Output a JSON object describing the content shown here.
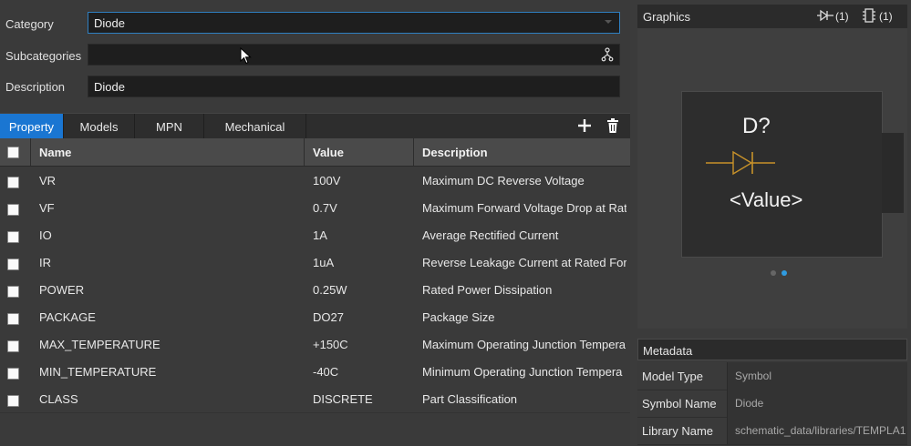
{
  "form": {
    "category": {
      "label": "Category",
      "value": "Diode"
    },
    "subcategories": {
      "label": "Subcategories",
      "value": ""
    },
    "description": {
      "label": "Description",
      "value": "Diode"
    }
  },
  "tabs": [
    "Property",
    "Models",
    "MPN",
    "Mechanical"
  ],
  "table": {
    "headers": {
      "name": "Name",
      "value": "Value",
      "description": "Description"
    },
    "rows": [
      {
        "name": "VR",
        "value": "100V",
        "description": "Maximum DC Reverse Voltage"
      },
      {
        "name": "VF",
        "value": "0.7V",
        "description": "Maximum Forward Voltage Drop at Rat"
      },
      {
        "name": "IO",
        "value": "1A",
        "description": "Average Rectified Current"
      },
      {
        "name": "IR",
        "value": "1uA",
        "description": "Reverse Leakage Current at Rated Forw"
      },
      {
        "name": "POWER",
        "value": "0.25W",
        "description": "Rated Power Dissipation"
      },
      {
        "name": "PACKAGE",
        "value": "DO27",
        "description": "Package Size"
      },
      {
        "name": "MAX_TEMPERATURE",
        "value": "+150C",
        "description": "Maximum Operating Junction Tempera"
      },
      {
        "name": "MIN_TEMPERATURE",
        "value": "-40C",
        "description": "Minimum Operating Junction Tempera"
      },
      {
        "name": "CLASS",
        "value": "DISCRETE",
        "description": "Part Classification"
      }
    ]
  },
  "graphics": {
    "title": "Graphics",
    "symbol_count": "(1)",
    "footprint_count": "(1)",
    "ref_label": "D?",
    "value_label": "<Value>",
    "active_page": 2,
    "page_count": 2
  },
  "metadata": {
    "title": "Metadata",
    "rows": [
      {
        "label": "Model Type",
        "value": "Symbol"
      },
      {
        "label": "Symbol Name",
        "value": "Diode"
      },
      {
        "label": "Library Name",
        "value": "schematic_data/libraries/TEMPLA1"
      }
    ]
  },
  "colors": {
    "accent": "#1a76d2",
    "symbol": "#c8922a"
  }
}
